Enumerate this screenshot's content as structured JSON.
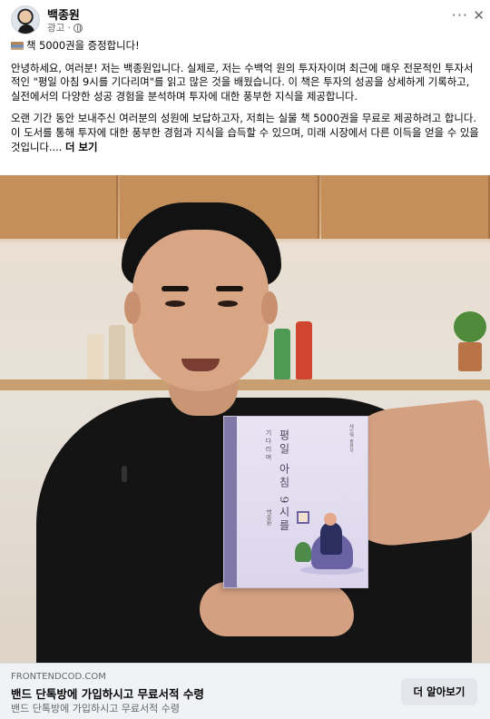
{
  "post": {
    "author": "백종원",
    "meta_label": "광고 ·",
    "privacy_icon": "globe-icon",
    "more_icon": "ellipsis-icon",
    "close_icon": "close-icon",
    "close_glyph": "✕",
    "more_glyph": "···"
  },
  "body": {
    "headline": "책 5000권을 증정합니다!",
    "paragraph1": "안녕하세요, 여러분! 저는 백종원입니다. 실제로, 저는 수백억 원의 투자자이며 최근에 매우 전문적인 투자서적인 \"평일 아침 9시를 기다리며\"를 읽고 많은 것을 배웠습니다. 이 책은 투자의 성공을 상세하게 기록하고, 실전에서의 다양한 성공 경험을 분석하며 투자에 대한 풍부한 지식을 제공합니다.",
    "paragraph2": "오랜 기간 동안 보내주신 여러분의 성원에 보답하고자, 저희는 실물 책 5000권을 무료로 제공하려고 합니다. 이 도서를 통해 투자에 대한 풍부한 경험과 지식을 습득할 수 있으며, 미래 시장에서 다른 이득을 얻을 수 있을 것입니다....",
    "see_more": "더 보기"
  },
  "book": {
    "title": "평일 아침 9시를",
    "subtitle": "기다리며",
    "publisher": "체인백 출판사",
    "author": "백종원"
  },
  "link": {
    "domain": "FRONTENDCOD.COM",
    "headline": "밴드 단톡방에 가입하시고 무료서적 수령",
    "description": "밴드 단톡방에 가입하시고 무료서적 수령",
    "cta_label": "더 알아보기"
  },
  "colors": {
    "link_bar_bg": "#f0f2f5",
    "cta_bg": "#e4e6eb",
    "secondary_text": "#65676b",
    "primary_text": "#050505"
  }
}
